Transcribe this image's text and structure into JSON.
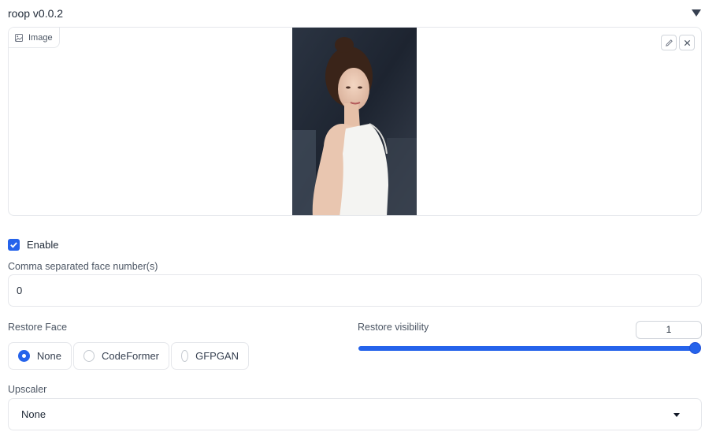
{
  "header": {
    "title": "roop v0.0.2",
    "collapse_icon": "triangle-down-icon"
  },
  "image_panel": {
    "label": "Image",
    "label_icon": "image-icon",
    "edit_icon": "pencil-icon",
    "clear_icon": "close-icon"
  },
  "enable": {
    "label": "Enable",
    "checked": true
  },
  "faces": {
    "label": "Comma separated face number(s)",
    "value": "0"
  },
  "restore_face": {
    "label": "Restore Face",
    "options": [
      "None",
      "CodeFormer",
      "GFPGAN"
    ],
    "selected": "None"
  },
  "restore_visibility": {
    "label": "Restore visibility",
    "value": "1",
    "slider_fraction": 1.0
  },
  "upscaler": {
    "label": "Upscaler",
    "value": "None",
    "caret_icon": "caret-down-icon"
  },
  "colors": {
    "accent": "#2563eb",
    "border": "#e5e7eb"
  }
}
